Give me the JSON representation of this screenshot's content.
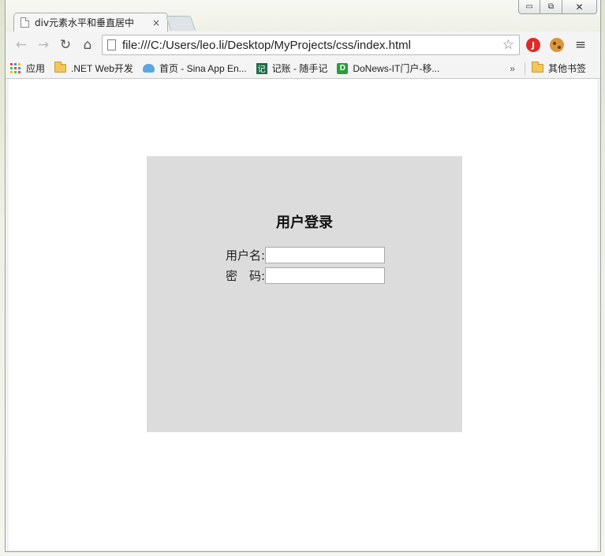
{
  "tab": {
    "title": "div元素水平和垂直居中",
    "close": "×"
  },
  "window": {
    "minimize": "▭",
    "maximize": "⧉",
    "close": "✕"
  },
  "toolbar": {
    "back": "←",
    "forward": "→",
    "reload": "↻",
    "home": "⌂",
    "url": "file:///C:/Users/leo.li/Desktop/MyProjects/css/index.html",
    "star": "☆",
    "ext_red": "J",
    "menu": "≡"
  },
  "bookmarks": {
    "items": [
      {
        "label": "应用",
        "icon": "apps-icon"
      },
      {
        "label": ".NET Web开发",
        "icon": "folder-icon"
      },
      {
        "label": "首页 - Sina App En...",
        "icon": "cloud-icon"
      },
      {
        "label": "记账 - 随手记",
        "icon": "note-icon"
      },
      {
        "label": "DoNews-IT门户-移...",
        "icon": "donews-icon"
      }
    ],
    "more": "»",
    "other": "其他书签"
  },
  "page": {
    "title": "用户登录",
    "username_label": "用户名:",
    "password_label": "密　码:",
    "username_value": "",
    "password_value": ""
  },
  "colors": {
    "login_box_bg": "#dcdcdc",
    "page_bg": "#ffffff"
  }
}
